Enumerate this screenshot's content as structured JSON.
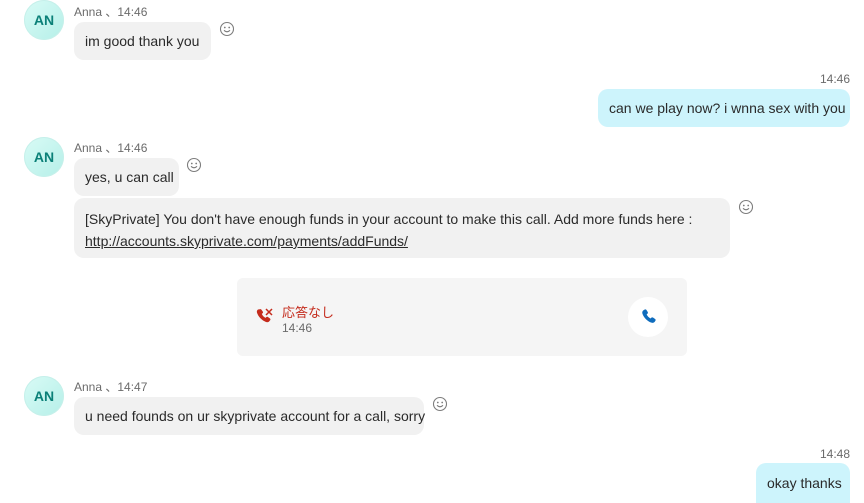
{
  "messages": {
    "m1": {
      "avatar": "AN",
      "meta": "Anna 、14:46",
      "text": "im good thank you"
    },
    "m2": {
      "time": "14:46",
      "text": "can we play now?  i wnna sex with you"
    },
    "m3": {
      "avatar": "AN",
      "meta": "Anna 、14:46",
      "text": "yes, u can call"
    },
    "m4": {
      "line1": "[SkyPrivate] You don't have enough funds in your account to make this call. Add more funds here :",
      "link": "http://accounts.skyprivate.com/payments/addFunds/"
    },
    "call": {
      "status": "応答なし",
      "time": "14:46",
      "status_color": "#c42b1c",
      "button_color": "#0f6cbd"
    },
    "m5": {
      "avatar": "AN",
      "meta": "Anna 、14:47",
      "text": "u need founds on ur skyprivate account for a call, sorry"
    },
    "m6": {
      "time": "14:48",
      "text": "okay thanks"
    }
  },
  "icons": {
    "reaction": "smiley-face-icon",
    "missed_call": "missed-call-icon",
    "call_back": "phone-icon"
  }
}
